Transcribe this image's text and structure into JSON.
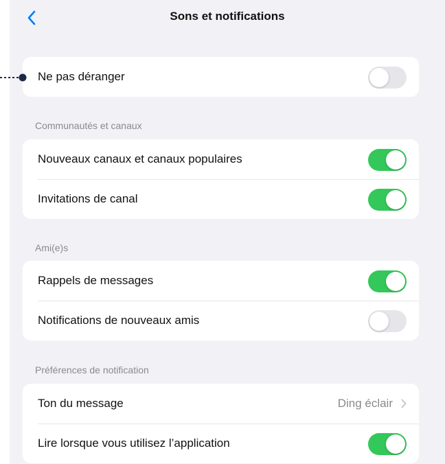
{
  "nav": {
    "title": "Sons et notifications"
  },
  "dnd": {
    "label": "Ne pas déranger",
    "on": false
  },
  "communities": {
    "header": "Communautés et canaux",
    "items": [
      {
        "label": "Nouveaux canaux et canaux populaires",
        "on": true
      },
      {
        "label": "Invitations de canal",
        "on": true
      }
    ]
  },
  "friends": {
    "header": "Ami(e)s",
    "items": [
      {
        "label": "Rappels de messages",
        "on": true
      },
      {
        "label": "Notifications de nouveaux amis",
        "on": false
      }
    ]
  },
  "prefs": {
    "header": "Préférences de notification",
    "tone": {
      "label": "Ton du message",
      "value": "Ding éclair"
    },
    "read": {
      "label": "Lire lorsque vous utilisez l’application",
      "on": true
    }
  },
  "colors": {
    "toggle_on": "#34c759",
    "toggle_off": "#e5e5ea",
    "back": "#007aff",
    "background": "#f2f2f6"
  }
}
